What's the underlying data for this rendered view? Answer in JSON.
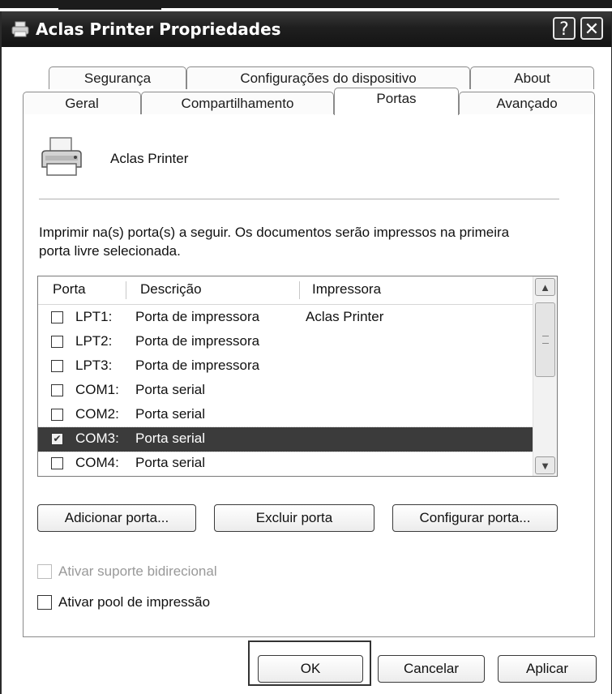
{
  "window": {
    "title": "Aclas Printer Propriedades",
    "help_glyph": "?",
    "close_glyph": "✕"
  },
  "tabs": {
    "row1": [
      "Segurança",
      "Configurações do dispositivo",
      "About"
    ],
    "row2": [
      "Geral",
      "Compartilhamento",
      "Portas",
      "Avançado"
    ],
    "active": "Portas"
  },
  "printer": {
    "name": "Aclas Printer"
  },
  "instructions": "Imprimir na(s) porta(s) a seguir. Os documentos serão impressos na primeira porta livre selecionada.",
  "ports": {
    "columns": [
      "Porta",
      "Descrição",
      "Impressora"
    ],
    "rows": [
      {
        "port": "LPT1:",
        "description": "Porta de impressora",
        "printer": "Aclas Printer",
        "checked": false,
        "selected": false
      },
      {
        "port": "LPT2:",
        "description": "Porta de impressora",
        "printer": "",
        "checked": false,
        "selected": false
      },
      {
        "port": "LPT3:",
        "description": "Porta de impressora",
        "printer": "",
        "checked": false,
        "selected": false
      },
      {
        "port": "COM1:",
        "description": "Porta serial",
        "printer": "",
        "checked": false,
        "selected": false
      },
      {
        "port": "COM2:",
        "description": "Porta serial",
        "printer": "",
        "checked": false,
        "selected": false
      },
      {
        "port": "COM3:",
        "description": "Porta serial",
        "printer": "",
        "checked": true,
        "selected": true
      },
      {
        "port": "COM4:",
        "description": "Porta serial",
        "printer": "",
        "checked": false,
        "selected": false
      }
    ]
  },
  "buttons": {
    "add_port": "Adicionar porta...",
    "delete_port": "Excluir porta",
    "configure_port": "Configurar porta...",
    "ok": "OK",
    "cancel": "Cancelar",
    "apply": "Aplicar"
  },
  "options": {
    "bidirectional": {
      "label": "Ativar suporte bidirecional",
      "checked": false,
      "disabled": true
    },
    "pooling": {
      "label": "Ativar pool de impressão",
      "checked": false,
      "disabled": false
    }
  },
  "icons": {
    "app": "printer-icon",
    "help": "help-icon",
    "close": "close-icon",
    "scroll_up": "chevron-up-icon",
    "scroll_down": "chevron-down-icon"
  }
}
